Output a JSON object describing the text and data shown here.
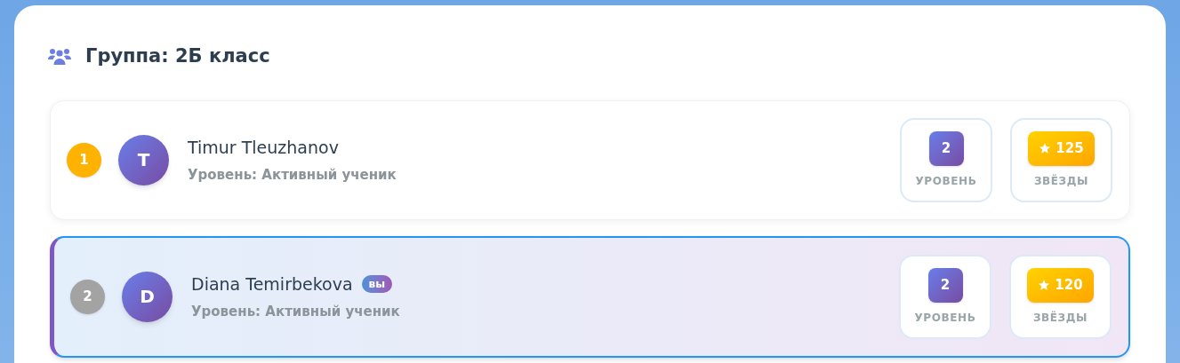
{
  "group": {
    "title": "Группа: 2Б класс"
  },
  "members": [
    {
      "rank": "1",
      "color": "#ffb300",
      "initial": "T",
      "name": "Timur Tleuzhanov",
      "level_text": "Уровень: Активный ученик",
      "selected": false,
      "level_value": "2",
      "level_label": "УРОВЕНЬ",
      "stars_value": "125",
      "stars_label": "ЗВЁЗДЫ"
    },
    {
      "rank": "2",
      "color": "#a3a3a3",
      "initial": "D",
      "name": "Diana Temirbekova",
      "you_badge": "вы",
      "level_text": "Уровень: Активный ученик",
      "selected": true,
      "level_value": "2",
      "level_label": "УРОВЕНЬ",
      "stars_value": "120",
      "stars_label": "ЗВЁЗДЫ"
    }
  ]
}
